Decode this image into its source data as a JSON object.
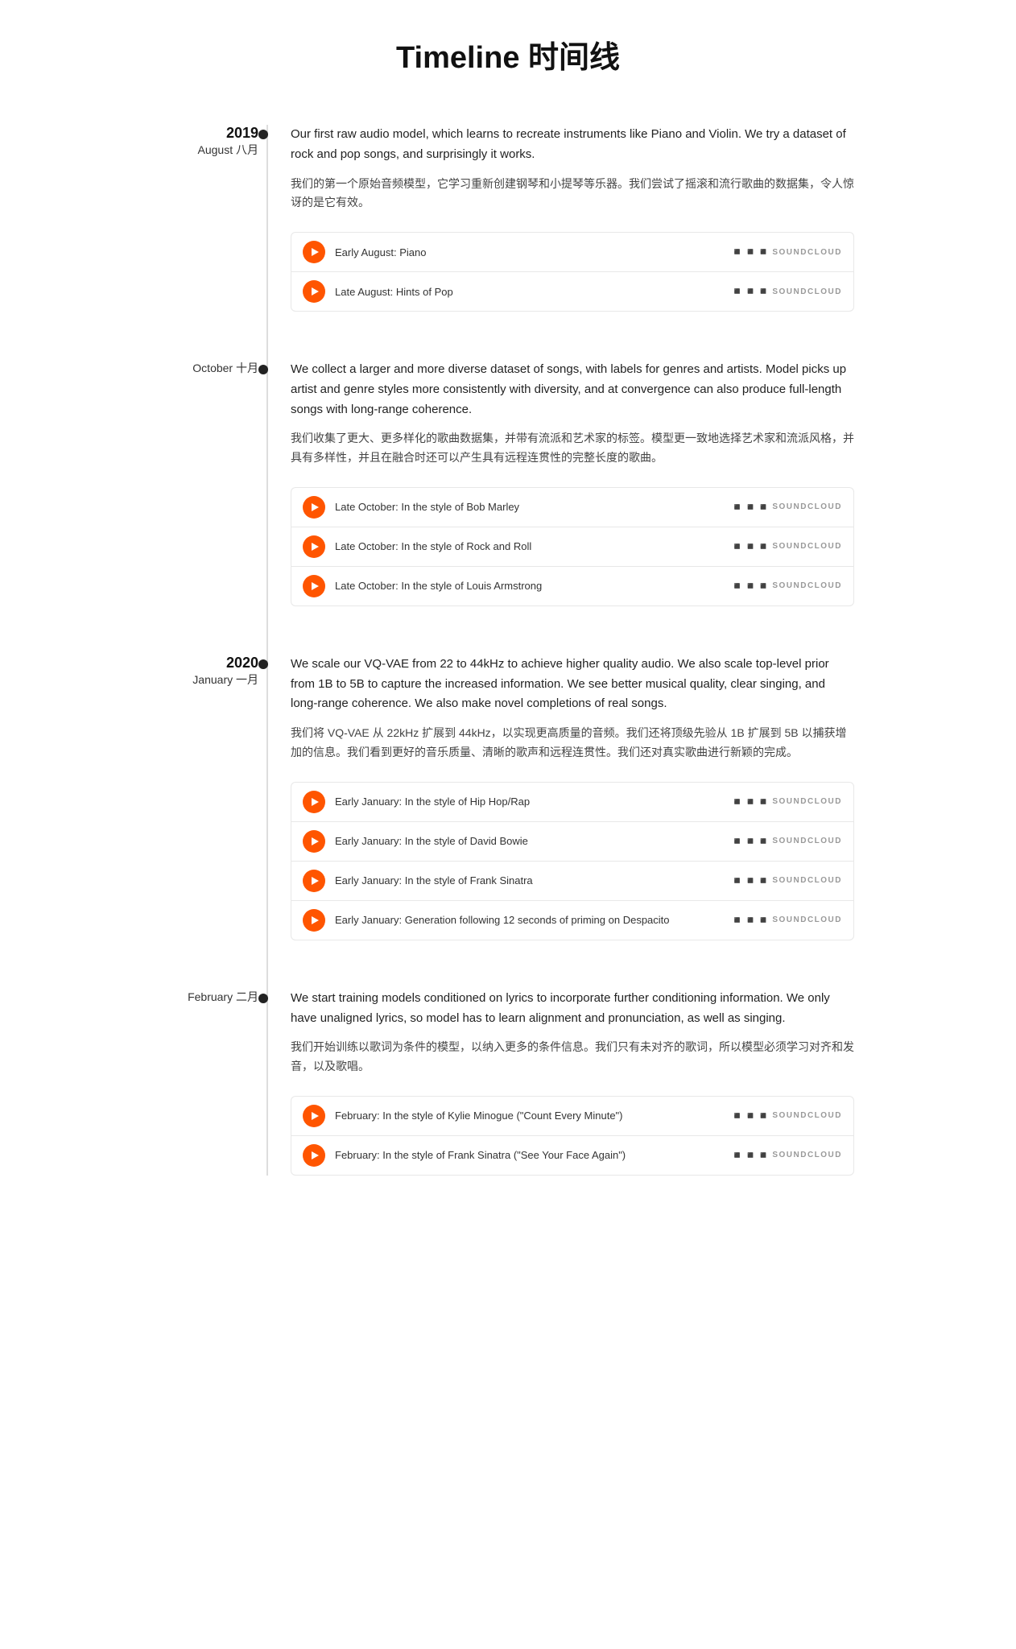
{
  "page": {
    "title": "Timeline 时间线"
  },
  "sections": [
    {
      "id": "2019-august",
      "year": "2019",
      "month_en": "August",
      "month_zh": "八月",
      "show_year": true,
      "description_en": "Our first raw audio model, which learns to recreate instruments like Piano and Violin. We try a dataset of rock and pop songs, and surprisingly it works.",
      "description_zh": "我们的第一个原始音频模型，它学习重新创建钢琴和小提琴等乐器。我们尝试了摇滚和流行歌曲的数据集，令人惊讶的是它有效。",
      "tracks": [
        {
          "title": "Early August: Piano"
        },
        {
          "title": "Late August: Hints of Pop"
        }
      ]
    },
    {
      "id": "2019-october",
      "year": "",
      "month_en": "October",
      "month_zh": "十月",
      "show_year": false,
      "description_en": "We collect a larger and more diverse dataset of songs, with labels for genres and artists. Model picks up artist and genre styles more consistently with diversity, and at convergence can also produce full-length songs with long-range coherence.",
      "description_zh": "我们收集了更大、更多样化的歌曲数据集，并带有流派和艺术家的标签。模型更一致地选择艺术家和流派风格，并具有多样性，并且在融合时还可以产生具有远程连贯性的完整长度的歌曲。",
      "tracks": [
        {
          "title": "Late October: In the style of Bob Marley"
        },
        {
          "title": "Late October: In the style of Rock and Roll"
        },
        {
          "title": "Late October: In the style of Louis Armstrong"
        }
      ]
    },
    {
      "id": "2020-january",
      "year": "2020",
      "month_en": "January",
      "month_zh": "一月",
      "show_year": true,
      "description_en": "We scale our VQ-VAE from 22 to 44kHz to achieve higher quality audio. We also scale top-level prior from 1B to 5B to capture the increased information. We see better musical quality, clear singing, and long-range coherence. We also make novel completions of real songs.",
      "description_zh": "我们将 VQ-VAE 从 22kHz 扩展到 44kHz，以实现更高质量的音频。我们还将顶级先验从 1B 扩展到 5B 以捕获增加的信息。我们看到更好的音乐质量、清晰的歌声和远程连贯性。我们还对真实歌曲进行新颖的完成。",
      "tracks": [
        {
          "title": "Early January: In the style of Hip Hop/Rap"
        },
        {
          "title": "Early January: In the style of David Bowie"
        },
        {
          "title": "Early January: In the style of Frank Sinatra"
        },
        {
          "title": "Early January: Generation following 12 seconds of priming on Despacito"
        }
      ]
    },
    {
      "id": "2020-february",
      "year": "",
      "month_en": "February",
      "month_zh": "二月",
      "show_year": false,
      "description_en": "We start training models conditioned on lyrics to incorporate further conditioning information. We only have unaligned lyrics, so model has to learn alignment and pronunciation, as well as singing.",
      "description_zh": "我们开始训练以歌词为条件的模型，以纳入更多的条件信息。我们只有未对齐的歌词，所以模型必须学习对齐和发音，以及歌唱。",
      "tracks": [
        {
          "title": "February: In the style of Kylie Minogue (\"Count Every Minute\")"
        },
        {
          "title": "February: In the style of Frank Sinatra (\"See Your Face Again\")"
        }
      ]
    }
  ],
  "soundcloud_label": "SOUNDCLOUD"
}
